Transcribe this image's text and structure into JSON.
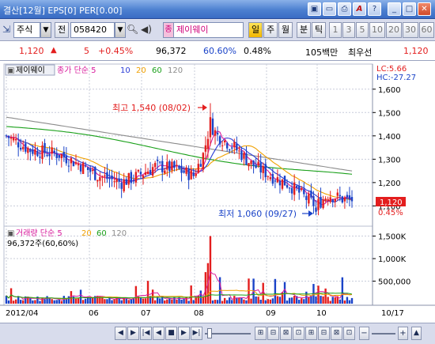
{
  "window": {
    "title": "결산[12월] EPS[0] PER[0.00]",
    "buttons": [
      "▣",
      "▭",
      "🖨",
      "A",
      "?",
      "_",
      "□",
      "X"
    ]
  },
  "toolbar": {
    "market_type": "주식",
    "prev_label": "전",
    "code": "058420",
    "stock_name_badge": "종",
    "stock_name": "제이웨이",
    "period_buttons": [
      "일",
      "주",
      "월"
    ],
    "minute_label": "분",
    "tick_label": "틱",
    "intervals": [
      "1",
      "3",
      "5",
      "10",
      "20",
      "30",
      "60"
    ]
  },
  "quote": {
    "price": "1,120",
    "change_arrow": "▲",
    "change": "5",
    "change_pct": "+0.45%",
    "volume": "96,372",
    "volume_ratio": "60.60%",
    "turnover_pct": "0.48%",
    "trade_value": "105백만",
    "best_ask_label": "최우선",
    "best_ask": "1,120"
  },
  "colors": {
    "up": "#e31e1e",
    "down": "#1a43c8",
    "ma5": "#d81b9c",
    "ma10": "#2a3cd6",
    "ma20": "#f0a000",
    "ma60": "#1aa01a",
    "ma120": "#8c8c8c",
    "accent": "#3a6cc4"
  },
  "price_panel": {
    "stock_label": "제이웨이",
    "legend": [
      {
        "text": "종가 단순 5",
        "color": "#d81b9c"
      },
      {
        "text": "10",
        "color": "#2a3cd6"
      },
      {
        "text": "20",
        "color": "#f0a000"
      },
      {
        "text": "60",
        "color": "#1aa01a"
      },
      {
        "text": "120",
        "color": "#8c8c8c"
      }
    ],
    "lc_label": "LC:5.66",
    "hc_label": "HC:-27.27",
    "high_annotation": "최고 1,540 (08/02)",
    "low_annotation": "최저 1,060 (09/27)",
    "current_price_tag": "1,120",
    "current_pct_tag": "0.45%"
  },
  "volume_panel": {
    "legend": [
      {
        "text": "거래량 단순 5",
        "color": "#d81b9c"
      },
      {
        "text": "20",
        "color": "#f0a000"
      },
      {
        "text": "60",
        "color": "#1aa01a"
      },
      {
        "text": "120",
        "color": "#8c8c8c"
      }
    ],
    "info": "96,372주(60,60%)"
  },
  "chart_data": {
    "type": "candlestick",
    "price_axis": {
      "ticks": [
        "1,600",
        "1,500",
        "1,400",
        "1,300",
        "1,200",
        "1,100"
      ],
      "values": [
        1600,
        1500,
        1400,
        1300,
        1200,
        1100
      ],
      "ylim": [
        1020,
        1650
      ]
    },
    "volume_axis": {
      "ticks": [
        "1,500K",
        "1,000K",
        "500,000"
      ],
      "values": [
        1500000,
        1000000,
        500000
      ],
      "ylim": [
        0,
        1650000
      ]
    },
    "date_ticks": [
      "2012/04",
      "06",
      "07",
      "08",
      "09",
      "10",
      "10/17"
    ],
    "high": {
      "value": 1540,
      "date": "08/02"
    },
    "low": {
      "value": 1060,
      "date": "09/27"
    },
    "last": {
      "value": 1120,
      "change_pct": 0.45
    }
  },
  "bottom_nav": {
    "buttons": [
      "◀",
      "▶",
      "|◀",
      "◀",
      "■",
      "▶",
      "▶|",
      "−",
      "+",
      "▲"
    ],
    "zoom_labels": [
      "—",
      "+"
    ]
  }
}
